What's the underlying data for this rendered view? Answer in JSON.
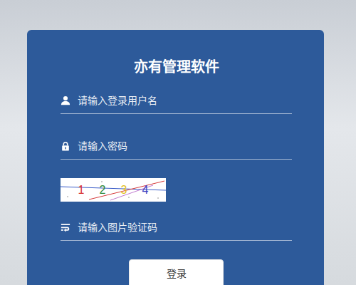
{
  "app": {
    "title": "亦有管理软件"
  },
  "fields": [
    {
      "placeholder": "请输入登录用户名",
      "kind": "text"
    },
    {
      "placeholder": "请输入密码",
      "kind": "password"
    }
  ],
  "captcha": {
    "chars": [
      {
        "text": "1",
        "color": "#d8322c"
      },
      {
        "text": "2",
        "color": "#2f8a3b"
      },
      {
        "text": "3",
        "color": "#e3c21f"
      },
      {
        "text": "4",
        "color": "#3d3fbf"
      }
    ]
  },
  "captcha_field": {
    "placeholder": "请输入图片验证码"
  },
  "buttons": [
    "登录"
  ]
}
